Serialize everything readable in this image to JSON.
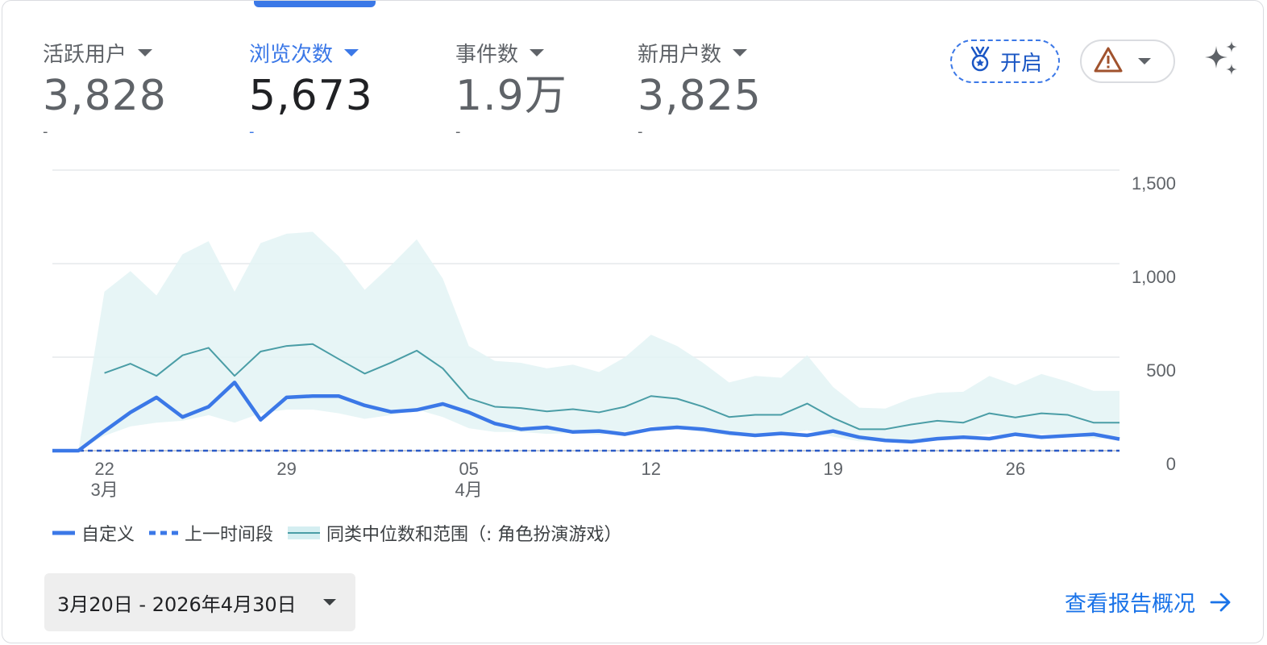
{
  "metrics": [
    {
      "label": "活跃用户",
      "value": "3,828",
      "delta": "-"
    },
    {
      "label": "浏览次数",
      "value": "5,673",
      "delta": "-",
      "active": true
    },
    {
      "label": "事件数",
      "value": "1.9万",
      "delta": "-"
    },
    {
      "label": "新用户数",
      "value": "3,825",
      "delta": "-"
    }
  ],
  "toolbar": {
    "open_label": "开启"
  },
  "legend": {
    "custom": "自定义",
    "previous": "上一时间段",
    "benchmark": "同类中位数和范围（: 角色扮演游戏）"
  },
  "date_range": "3月20日 - 2026年4月30日",
  "view_report": "查看报告概况",
  "colors": {
    "primary": "#3b78e7",
    "benchmark_line": "#4a9da6",
    "benchmark_band": "#e3f3f5",
    "warning": "#a0522d"
  },
  "chart_data": {
    "type": "line",
    "y_axis_position": "right",
    "ylim": [
      0,
      1500
    ],
    "y_ticks": [
      "1,500",
      "1,000",
      "500",
      "0"
    ],
    "y_tick_values": [
      1500,
      1000,
      500,
      0
    ],
    "x_ticks": [
      {
        "label": "22",
        "sublabel": "3月",
        "index": 2
      },
      {
        "label": "29",
        "sublabel": "",
        "index": 9
      },
      {
        "label": "05",
        "sublabel": "4月",
        "index": 16
      },
      {
        "label": "12",
        "sublabel": "",
        "index": 23
      },
      {
        "label": "19",
        "sublabel": "",
        "index": 30
      },
      {
        "label": "26",
        "sublabel": "",
        "index": 37
      }
    ],
    "dates": [
      "3/20",
      "3/21",
      "3/22",
      "3/23",
      "3/24",
      "3/25",
      "3/26",
      "3/27",
      "3/28",
      "3/29",
      "3/30",
      "3/31",
      "4/1",
      "4/2",
      "4/3",
      "4/4",
      "4/5",
      "4/6",
      "4/7",
      "4/8",
      "4/9",
      "4/10",
      "4/11",
      "4/12",
      "4/13",
      "4/14",
      "4/15",
      "4/16",
      "4/17",
      "4/18",
      "4/19",
      "4/20",
      "4/21",
      "4/22",
      "4/23",
      "4/24",
      "4/25",
      "4/26",
      "4/27",
      "4/28",
      "4/29",
      "4/30"
    ],
    "series": [
      {
        "name": "自定义",
        "values": [
          0,
          0,
          105,
          205,
          285,
          180,
          235,
          365,
          165,
          285,
          292,
          292,
          242,
          208,
          218,
          250,
          205,
          145,
          115,
          125,
          100,
          105,
          88,
          115,
          125,
          115,
          95,
          82,
          92,
          82,
          105,
          72,
          55,
          48,
          64,
          72,
          64,
          88,
          72,
          80,
          88,
          62
        ]
      },
      {
        "name": "上一时间段",
        "values": [
          0,
          0,
          0,
          0,
          0,
          0,
          0,
          0,
          0,
          0,
          0,
          0,
          0,
          0,
          0,
          0,
          0,
          0,
          0,
          0,
          0,
          0,
          0,
          0,
          0,
          0,
          0,
          0,
          0,
          0,
          0,
          0,
          0,
          0,
          0,
          0,
          0,
          0,
          0,
          0,
          0,
          0
        ]
      },
      {
        "name": "同类中位数和范围（: 角色扮演游戏）",
        "values": [
          0,
          0,
          415,
          465,
          400,
          510,
          550,
          400,
          530,
          560,
          570,
          490,
          412,
          470,
          535,
          440,
          280,
          235,
          228,
          210,
          222,
          205,
          235,
          292,
          278,
          235,
          180,
          192,
          192,
          252,
          175,
          115,
          115,
          140,
          160,
          150,
          200,
          178,
          200,
          192,
          150,
          150
        ],
        "range_max": [
          0,
          0,
          850,
          960,
          830,
          1050,
          1120,
          850,
          1110,
          1160,
          1170,
          1040,
          860,
          990,
          1130,
          920,
          560,
          480,
          470,
          440,
          460,
          420,
          500,
          620,
          560,
          470,
          365,
          400,
          390,
          510,
          340,
          230,
          225,
          280,
          310,
          315,
          400,
          350,
          410,
          370,
          320,
          320
        ],
        "range_min": [
          0,
          0,
          80,
          130,
          150,
          160,
          190,
          150,
          200,
          220,
          220,
          200,
          170,
          190,
          220,
          180,
          120,
          100,
          100,
          90,
          95,
          85,
          100,
          130,
          120,
          100,
          80,
          85,
          85,
          110,
          75,
          50,
          50,
          60,
          70,
          65,
          90,
          80,
          90,
          85,
          65,
          65
        ]
      }
    ]
  }
}
